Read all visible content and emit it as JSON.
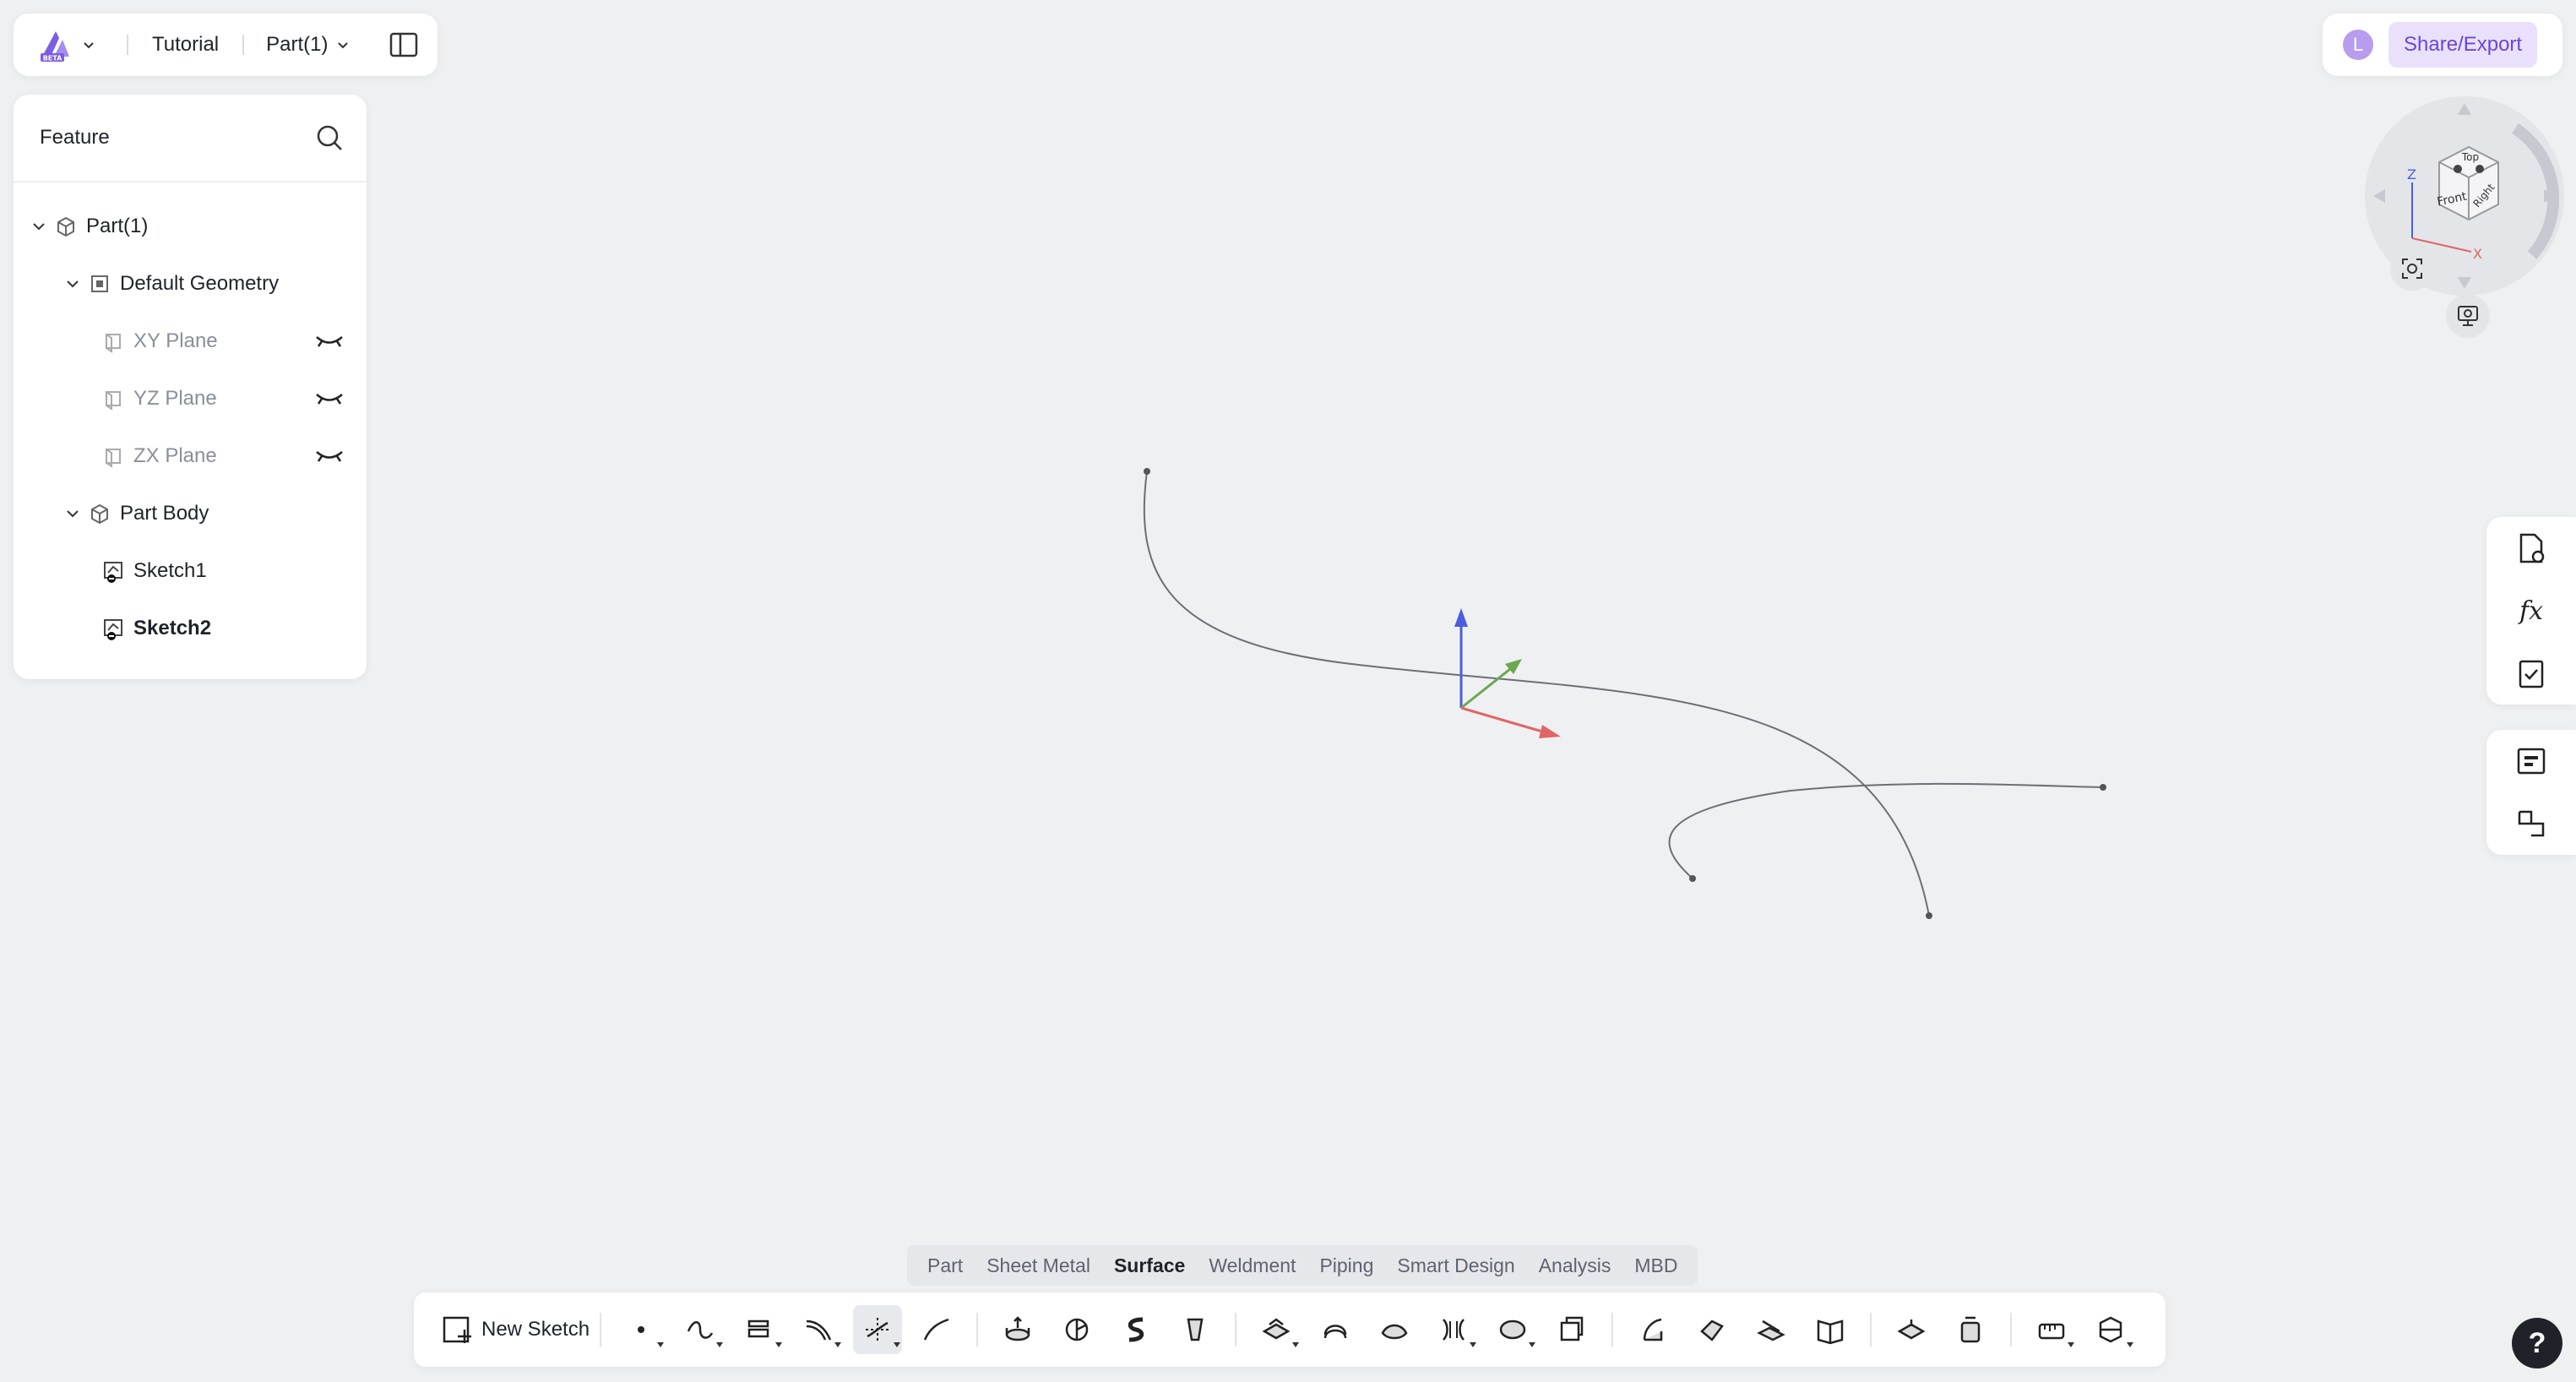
{
  "header": {
    "project_name": "Tutorial",
    "document_name": "Part(1)",
    "logo_icon": "app-logo-beta-icon",
    "logo_badge": "BETA"
  },
  "feature_panel": {
    "title": "Feature",
    "tree": [
      {
        "label": "Part(1)",
        "icon": "part-icon",
        "expanded": true
      },
      {
        "label": "Default Geometry",
        "icon": "geometry-icon",
        "expanded": true
      },
      {
        "label": "XY Plane",
        "icon": "plane-icon",
        "hidden": true
      },
      {
        "label": "YZ Plane",
        "icon": "plane-icon",
        "hidden": true
      },
      {
        "label": "ZX Plane",
        "icon": "plane-icon",
        "hidden": true
      },
      {
        "label": "Part Body",
        "icon": "body-icon",
        "expanded": true
      },
      {
        "label": "Sketch1",
        "icon": "sketch-icon"
      },
      {
        "label": "Sketch2",
        "icon": "sketch-icon",
        "selected": true
      }
    ]
  },
  "user": {
    "avatar_initial": "L",
    "share_label": "Share/Export"
  },
  "view_cube": {
    "faces": [
      "Top",
      "Front",
      "Right"
    ],
    "axes": [
      "Z",
      "X"
    ]
  },
  "tabs": [
    {
      "label": "Part",
      "active": false
    },
    {
      "label": "Sheet Metal",
      "active": false
    },
    {
      "label": "Surface",
      "active": true
    },
    {
      "label": "Weldment",
      "active": false
    },
    {
      "label": "Piping",
      "active": false
    },
    {
      "label": "Smart Design",
      "active": false
    },
    {
      "label": "Analysis",
      "active": false
    },
    {
      "label": "MBD",
      "active": false
    }
  ],
  "toolbar": {
    "new_sketch_label": "New Sketch"
  },
  "right_tools": [
    "document-settings-icon",
    "formula-icon",
    "checklist-icon",
    "template-icon",
    "transform-icon"
  ],
  "help_label": "?",
  "colors": {
    "accent": "#6c45d8",
    "axis_x": "#e06666",
    "axis_y": "#6aa84f",
    "axis_z": "#4a5ee0"
  }
}
